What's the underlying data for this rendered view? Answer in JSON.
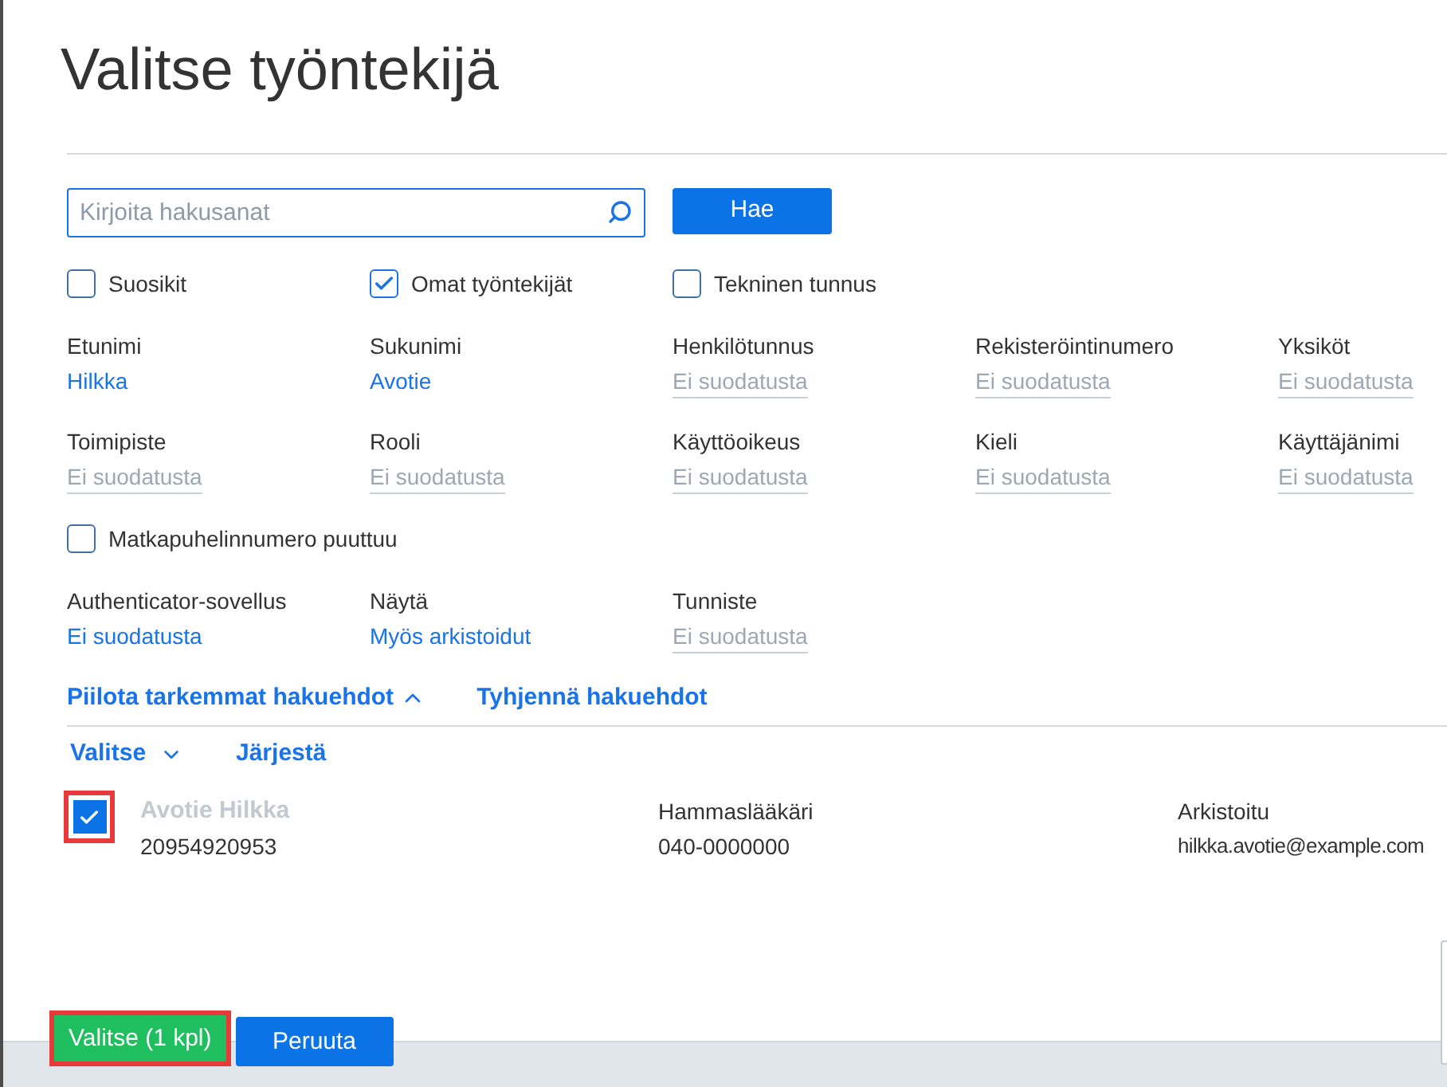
{
  "title": "Valitse työntekijä",
  "search": {
    "placeholder": "Kirjoita hakusanat",
    "button": "Hae"
  },
  "options": [
    {
      "label": "Suosikit",
      "checked": false
    },
    {
      "label": "Omat työntekijät",
      "checked": true
    },
    {
      "label": "Tekninen tunnus",
      "checked": false
    }
  ],
  "filters": [
    {
      "label": "Etunimi",
      "value": "Hilkka",
      "active": true
    },
    {
      "label": "Sukunimi",
      "value": "Avotie",
      "active": true
    },
    {
      "label": "Henkilötunnus",
      "value": "Ei suodatusta",
      "active": false
    },
    {
      "label": "Rekisteröintinumero",
      "value": "Ei suodatusta",
      "active": false
    },
    {
      "label": "Yksiköt",
      "value": "Ei suodatusta",
      "active": false
    },
    {
      "label": "Toimipiste",
      "value": "Ei suodatusta",
      "active": false
    },
    {
      "label": "Rooli",
      "value": "Ei suodatusta",
      "active": false
    },
    {
      "label": "Käyttöoikeus",
      "value": "Ei suodatusta",
      "active": false
    },
    {
      "label": "Kieli",
      "value": "Ei suodatusta",
      "active": false
    },
    {
      "label": "Käyttäjänimi",
      "value": "Ei suodatusta",
      "active": false
    }
  ],
  "mobile_missing": {
    "label": "Matkapuhelinnumero puuttuu",
    "checked": false
  },
  "more_filters": [
    {
      "label": "Authenticator-sovellus",
      "value": "Ei suodatusta",
      "active": true
    },
    {
      "label": "Näytä",
      "value": "Myös arkistoidut",
      "active": true
    },
    {
      "label": "Tunniste",
      "value": "Ei suodatusta",
      "active": false
    }
  ],
  "links": [
    {
      "label": "Piilota tarkemmat hakuehdot",
      "expanded": true
    },
    {
      "label": "Tyhjennä hakuehdot"
    }
  ],
  "toolbar": [
    {
      "label": "Valitse",
      "kind": "menu"
    },
    {
      "label": "Järjestä",
      "kind": "plain"
    }
  ],
  "results": [
    {
      "name": "Avotie Hilkka",
      "archived": true,
      "checked": true,
      "highlighted": true,
      "id": "20954920953",
      "role": "Hammaslääkäri",
      "phone": "040-0000000",
      "status": "Arkistoitu",
      "email": "hilkka.avotie@example.com"
    }
  ],
  "footer": {
    "buttons": [
      {
        "label": "Valitse (1 kpl)",
        "kind": "confirm",
        "highlighted": true
      },
      {
        "label": "Peruuta",
        "kind": "cancel",
        "highlighted": false
      }
    ]
  }
}
